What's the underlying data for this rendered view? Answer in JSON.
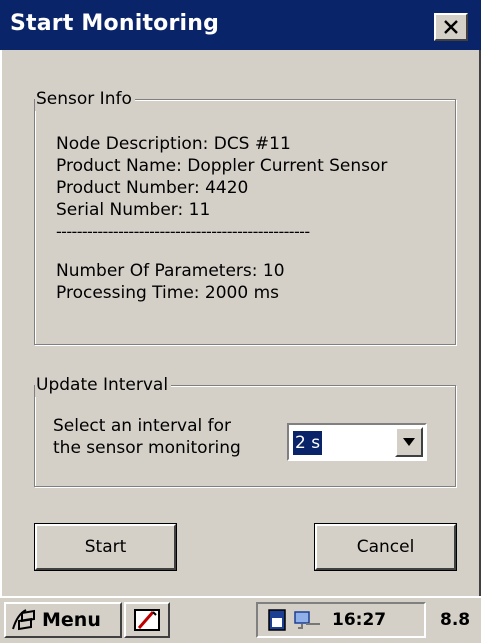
{
  "window": {
    "title": "Start Monitoring",
    "close_icon": "close-icon"
  },
  "sensor_info": {
    "label": "Sensor Info",
    "node_description": "Node Description: DCS #11",
    "product_name": "Product Name: Doppler Current Sensor",
    "product_number": "Product Number: 4420",
    "serial_number": "Serial Number: 11",
    "separator": "-------------------------------------------------",
    "num_parameters": "Number Of Parameters: 10",
    "processing_time": "Processing Time: 2000 ms"
  },
  "update_interval": {
    "label": "Update Interval",
    "prompt_line1": "Select an interval for",
    "prompt_line2": "the sensor monitoring",
    "selected_value": "2 s"
  },
  "buttons": {
    "start": "Start",
    "cancel": "Cancel"
  },
  "taskbar": {
    "menu_label": "Menu",
    "clock": "16:27",
    "version": "8.8"
  },
  "colors": {
    "titlebar": "#0a246a",
    "face": "#d4d0c8",
    "selection": "#0a246a"
  }
}
